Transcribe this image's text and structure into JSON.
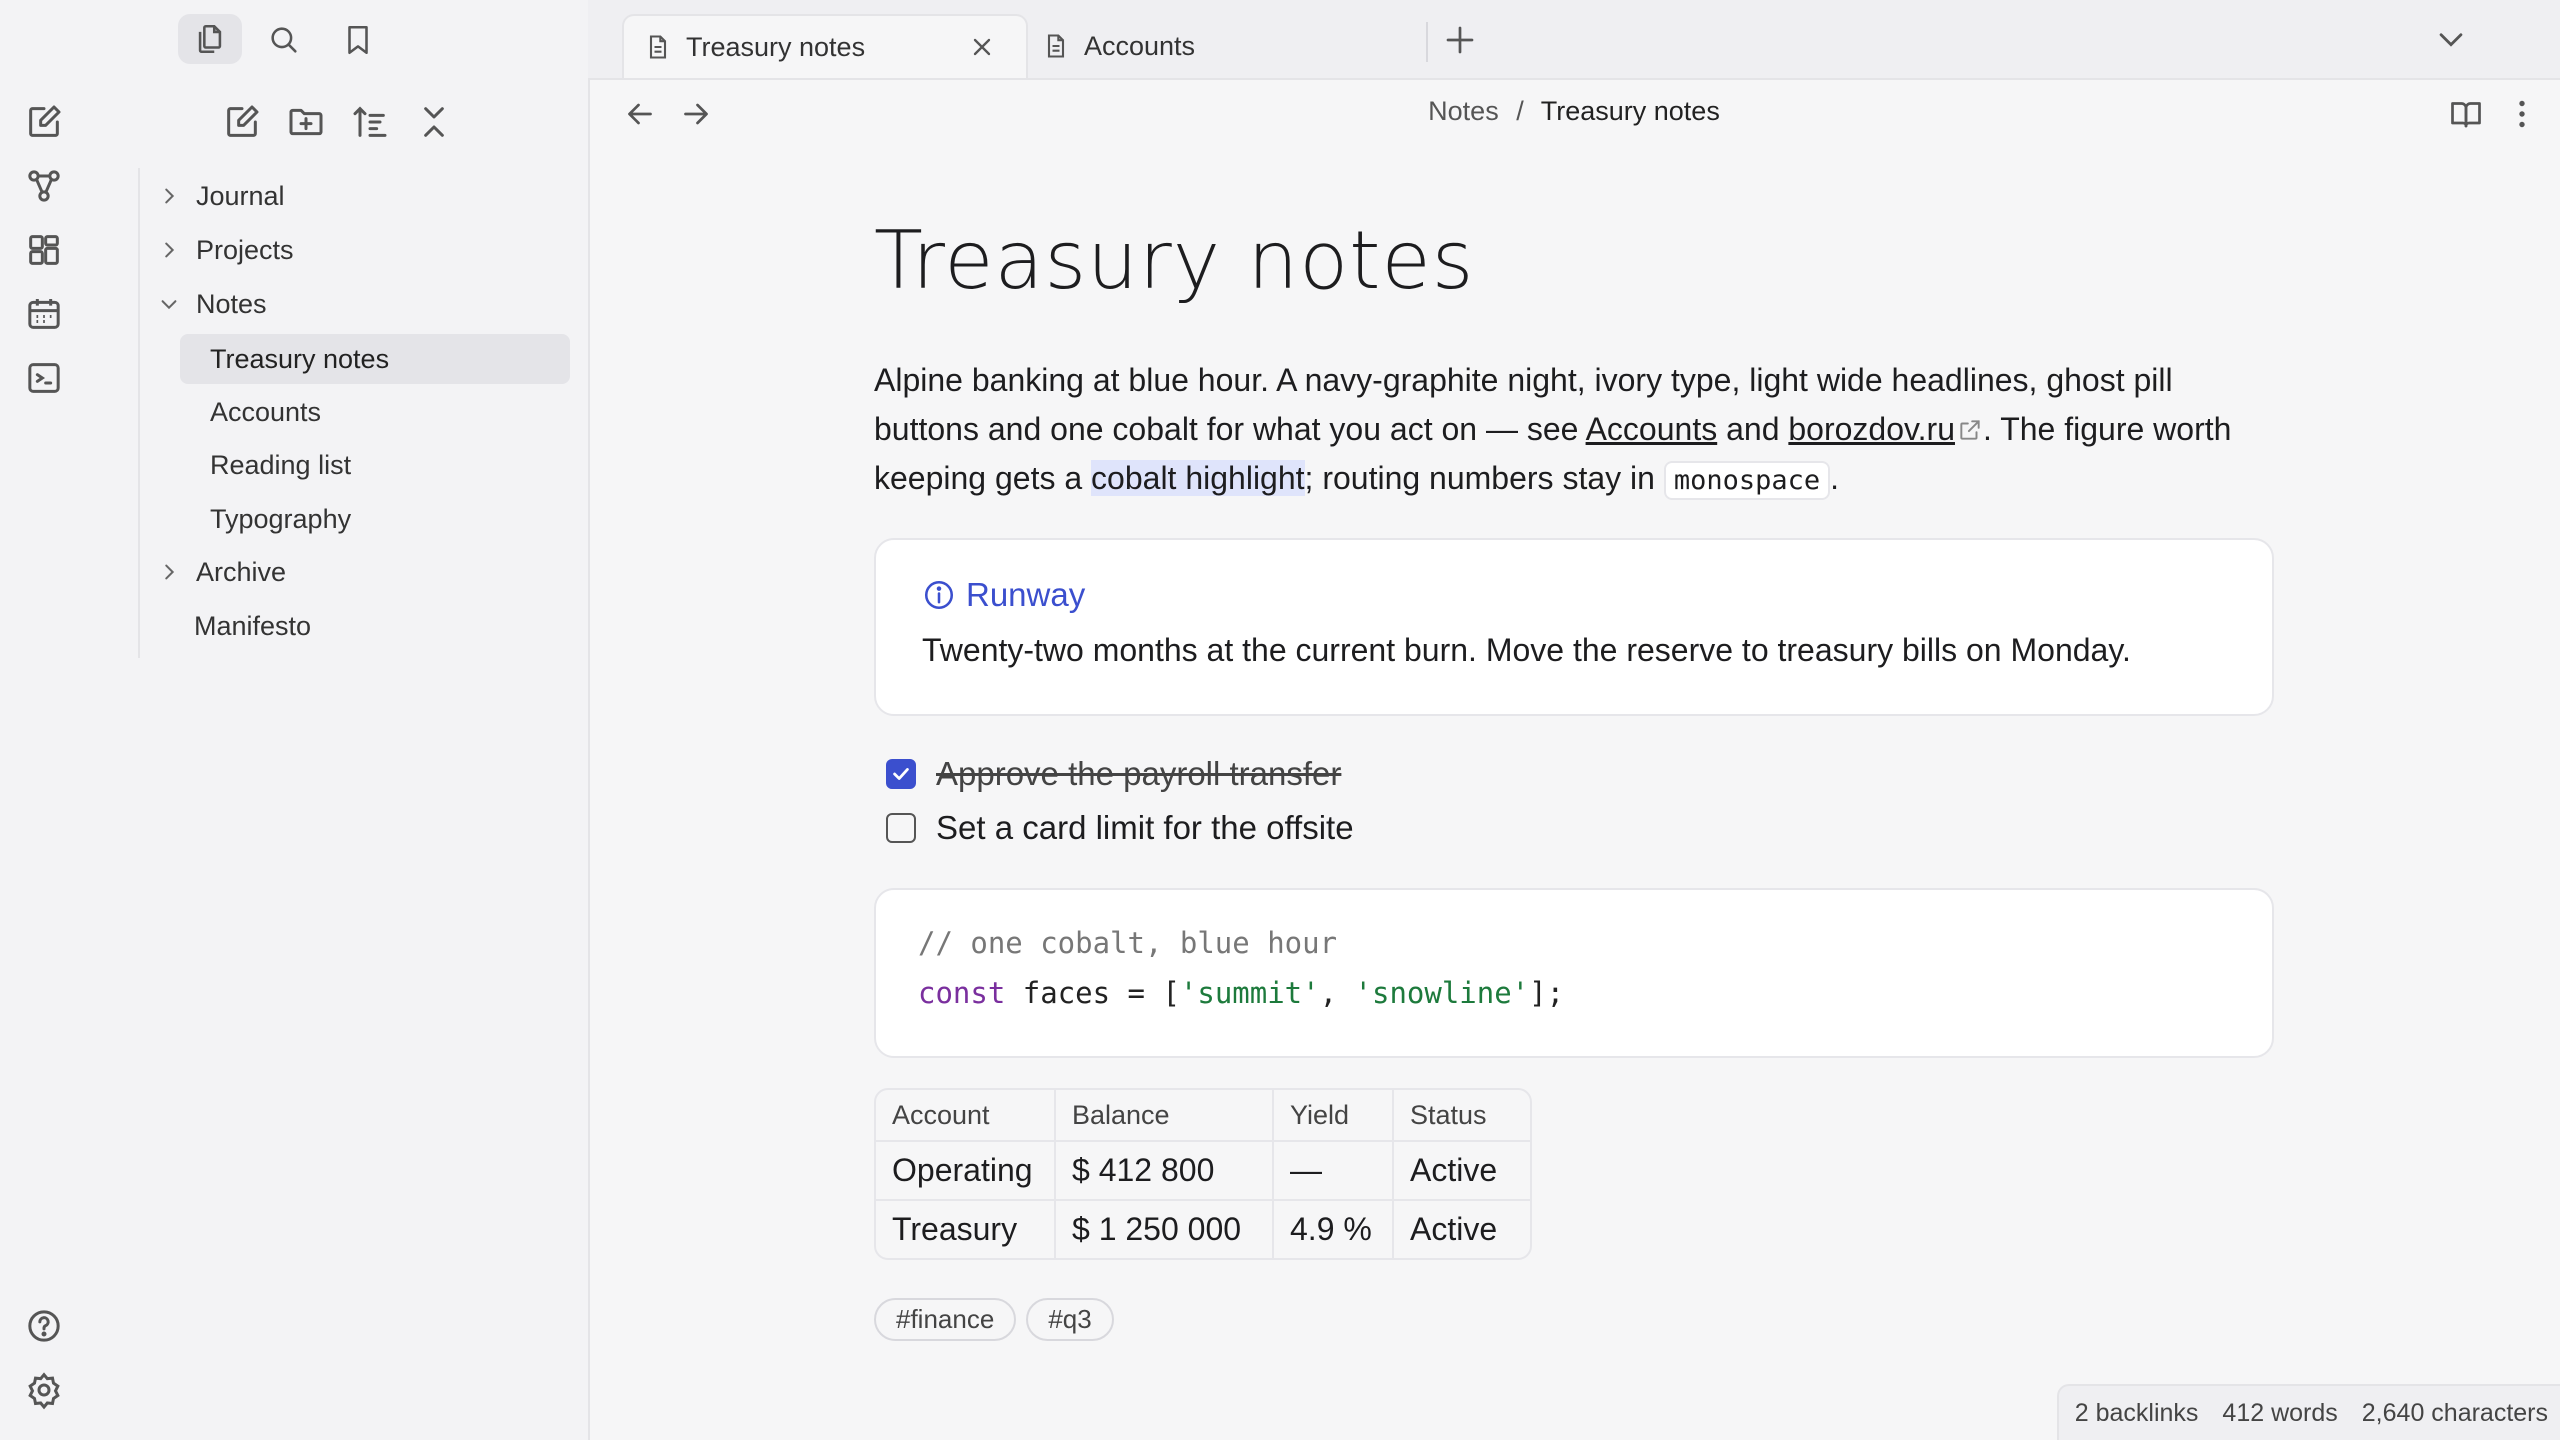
{
  "tabs": [
    {
      "label": "Treasury notes",
      "active": true
    },
    {
      "label": "Accounts",
      "active": false
    }
  ],
  "sidebar": {
    "tree": [
      {
        "label": "Journal",
        "type": "folder",
        "expanded": false
      },
      {
        "label": "Projects",
        "type": "folder",
        "expanded": false
      },
      {
        "label": "Notes",
        "type": "folder",
        "expanded": true,
        "children": [
          {
            "label": "Treasury notes",
            "selected": true
          },
          {
            "label": "Accounts"
          },
          {
            "label": "Reading list"
          },
          {
            "label": "Typography"
          }
        ]
      },
      {
        "label": "Archive",
        "type": "folder",
        "expanded": false
      },
      {
        "label": "Manifesto",
        "type": "file"
      }
    ]
  },
  "breadcrumb": {
    "parent": "Notes",
    "sep": "/",
    "current": "Treasury notes"
  },
  "note": {
    "title": "Treasury notes",
    "para": {
      "t1": "Alpine banking at blue hour. A navy-graphite night, ivory type, light wide headlines, ghost pill buttons and one cobalt for what you act on — see ",
      "link1": "Accounts",
      "t2": " and ",
      "link2": "borozdov.ru",
      "t3": ". The figure worth keeping gets a ",
      "highlight": "cobalt highlight",
      "t4": "; routing numbers stay in ",
      "code": "monospace",
      "t5": "."
    },
    "callout": {
      "title": "Runway",
      "body": "Twenty-two months at the current burn. Move the reserve to treasury bills on Monday."
    },
    "tasks": [
      {
        "label": "Approve the payroll transfer",
        "done": true
      },
      {
        "label": "Set a card limit for the offsite",
        "done": false
      }
    ],
    "code": {
      "comment": "// one cobalt, blue hour",
      "kw": "const",
      "mid": " faces = [",
      "s1": "'summit'",
      "comma": ", ",
      "s2": "'snowline'",
      "end": "];"
    },
    "table": {
      "headers": [
        "Account",
        "Balance",
        "Yield",
        "Status"
      ],
      "rows": [
        [
          "Operating",
          "$ 412 800",
          "—",
          "Active"
        ],
        [
          "Treasury",
          "$ 1 250 000",
          "4.9 %",
          "Active"
        ]
      ]
    },
    "tags": [
      "#finance",
      "#q3"
    ]
  },
  "status": {
    "backlinks": "2 backlinks",
    "words": "412 words",
    "chars": "2,640 characters"
  },
  "colors": {
    "accent": "#3b4fce",
    "highlight": "#dfe4fb"
  }
}
